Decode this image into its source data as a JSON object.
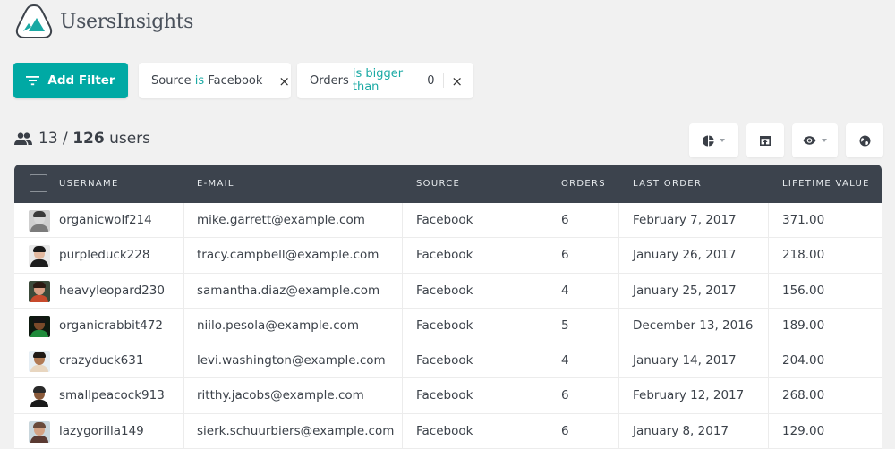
{
  "app": {
    "name": "UsersInsights",
    "accent_color": "#00a9a4",
    "header_color": "#3c434d"
  },
  "filters": {
    "add_filter_label": "Add Filter",
    "active": [
      {
        "field": "Source",
        "operator": "is",
        "value": "Facebook",
        "remove_icon": "×"
      },
      {
        "field": "Orders",
        "operator": "is bigger than",
        "value": "0",
        "remove_icon": "×"
      }
    ]
  },
  "summary": {
    "shown": "13",
    "separator": "/",
    "total": "126",
    "unit": "users",
    "icon": "users-icon"
  },
  "toolbar": {
    "buttons": [
      {
        "name": "segments",
        "icon": "pie-chart-icon",
        "has_dropdown": true
      },
      {
        "name": "export",
        "icon": "export-icon",
        "has_dropdown": false
      },
      {
        "name": "columns",
        "icon": "eye-icon",
        "has_dropdown": true
      },
      {
        "name": "map",
        "icon": "globe-icon",
        "has_dropdown": false
      }
    ]
  },
  "table": {
    "columns": [
      "USERNAME",
      "E-MAIL",
      "SOURCE",
      "ORDERS",
      "LAST ORDER",
      "LIFETIME VALUE"
    ],
    "rows": [
      {
        "username": "organicwolf214",
        "email": "mike.garrett@example.com",
        "source": "Facebook",
        "orders": "6",
        "last_order": "February 7, 2017",
        "lifetime_value": "371.00"
      },
      {
        "username": "purpleduck228",
        "email": "tracy.campbell@example.com",
        "source": "Facebook",
        "orders": "6",
        "last_order": "January 26, 2017",
        "lifetime_value": "218.00"
      },
      {
        "username": "heavyleopard230",
        "email": "samantha.diaz@example.com",
        "source": "Facebook",
        "orders": "4",
        "last_order": "January 25, 2017",
        "lifetime_value": "156.00"
      },
      {
        "username": "organicrabbit472",
        "email": "niilo.pesola@example.com",
        "source": "Facebook",
        "orders": "5",
        "last_order": "December 13, 2016",
        "lifetime_value": "189.00"
      },
      {
        "username": "crazyduck631",
        "email": "levi.washington@example.com",
        "source": "Facebook",
        "orders": "4",
        "last_order": "January 14, 2017",
        "lifetime_value": "204.00"
      },
      {
        "username": "smallpeacock913",
        "email": "ritthy.jacobs@example.com",
        "source": "Facebook",
        "orders": "6",
        "last_order": "February 12, 2017",
        "lifetime_value": "268.00"
      },
      {
        "username": "lazygorilla149",
        "email": "sierk.schuurbiers@example.com",
        "source": "Facebook",
        "orders": "6",
        "last_order": "January 8, 2017",
        "lifetime_value": "129.00"
      }
    ]
  }
}
